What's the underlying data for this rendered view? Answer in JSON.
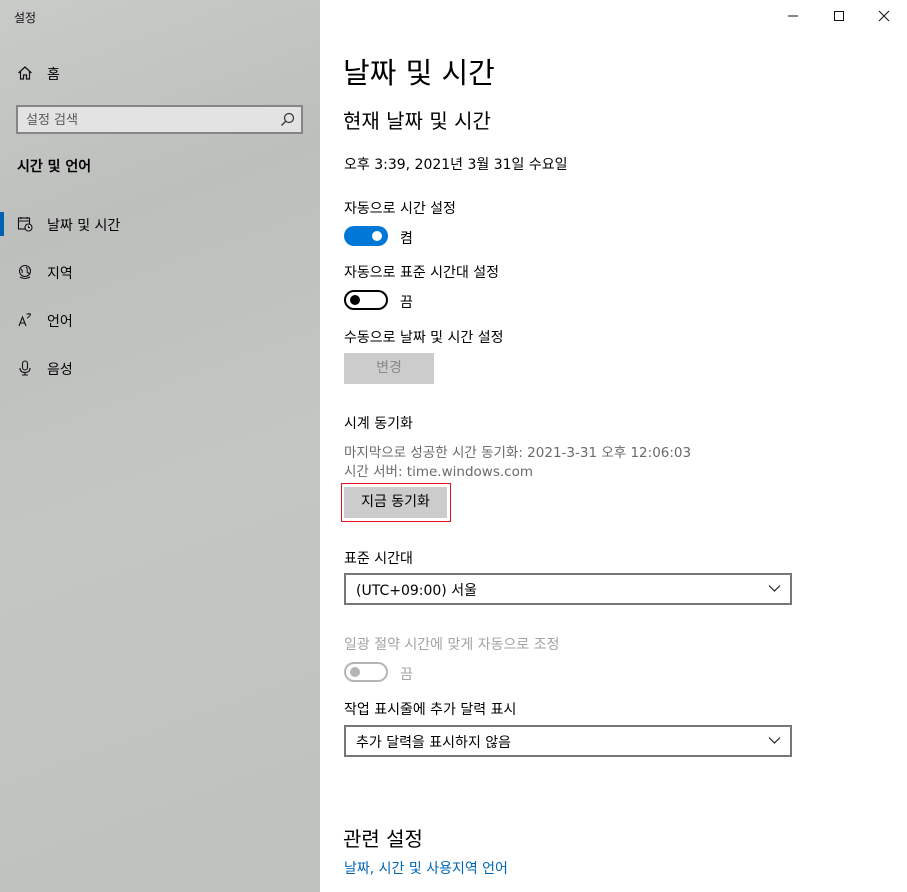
{
  "window": {
    "title": "설정"
  },
  "sidebar": {
    "home_label": "홈",
    "search_placeholder": "설정 검색",
    "section_title": "시간 및 언어",
    "items": [
      {
        "label": "날짜 및 시간",
        "icon": "calendar-clock-icon",
        "active": true
      },
      {
        "label": "지역",
        "icon": "globe-icon",
        "active": false
      },
      {
        "label": "언어",
        "icon": "language-icon",
        "active": false
      },
      {
        "label": "음성",
        "icon": "microphone-icon",
        "active": false
      }
    ]
  },
  "main": {
    "title": "날짜 및 시간",
    "subtitle": "현재 날짜 및 시간",
    "current_datetime": "오후 3:39, 2021년 3월 31일 수요일",
    "auto_time": {
      "label": "자동으로 시간 설정",
      "state": "켬",
      "on": true
    },
    "auto_timezone": {
      "label": "자동으로 표준 시간대 설정",
      "state": "끔",
      "on": false
    },
    "manual": {
      "label": "수동으로 날짜 및 시간 설정",
      "button": "변경"
    },
    "sync": {
      "title": "시계 동기화",
      "last_sync": "마지막으로 성공한 시간 동기화: 2021-3-31 오후 12:06:03",
      "server": "시간 서버: time.windows.com",
      "button": "지금 동기화"
    },
    "timezone": {
      "label": "표준 시간대",
      "value": "(UTC+09:00) 서울"
    },
    "dst": {
      "label": "일광 절약 시간에 맞게 자동으로 조정",
      "state": "끔",
      "enabled": false
    },
    "taskbar_calendar": {
      "label": "작업 표시줄에 추가 달력 표시",
      "value": "추가 달력을 표시하지 않음"
    },
    "related": {
      "title": "관련 설정",
      "link": "날짜, 시간 및 사용지역 언어"
    }
  },
  "colors": {
    "accent": "#0078d7",
    "highlight": "#e81123",
    "link": "#0066b4"
  }
}
